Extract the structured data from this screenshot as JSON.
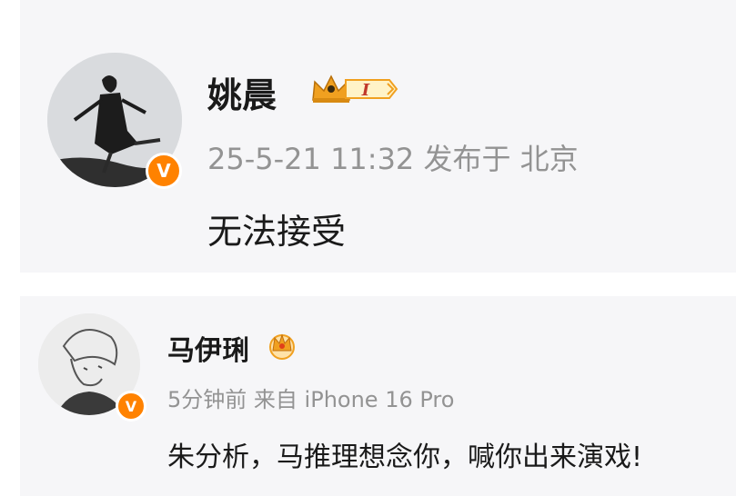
{
  "posts": [
    {
      "username": "姚晨",
      "level_badge": "I",
      "timestamp": "25-5-21 11:32",
      "posted_from": "发布于 北京",
      "content": "无法接受",
      "verified_icon": "verified-v-icon",
      "badge_color": "#f5a623"
    },
    {
      "username": "马伊琍",
      "timestamp": "5分钟前",
      "posted_from": "来自 iPhone 16 Pro",
      "content": "朱分析，马推理想念你，喊你出来演戏!",
      "verified_icon": "verified-v-icon",
      "badge_color": "#f5a623"
    }
  ],
  "colors": {
    "verified_orange": "#ff8200",
    "meta_gray": "#939393",
    "card_background": "#f6f6f8"
  }
}
